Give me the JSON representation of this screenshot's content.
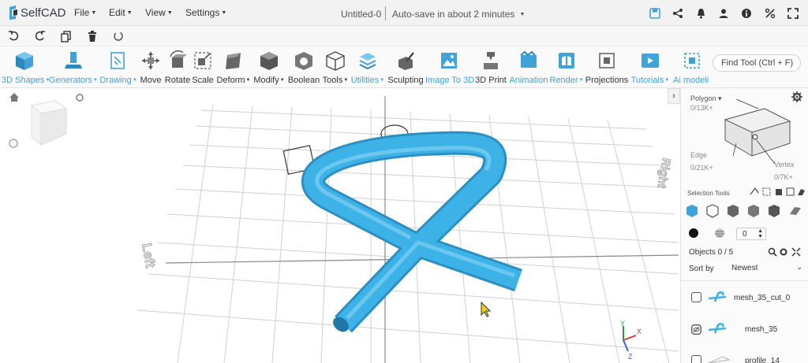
{
  "app": {
    "name": "SelfCAD",
    "doc_title": "Untitled-0",
    "autosave": "Auto-save in about 2 minutes"
  },
  "menu": [
    {
      "label": "File",
      "key": "file"
    },
    {
      "label": "Edit",
      "key": "edit"
    },
    {
      "label": "View",
      "key": "view"
    },
    {
      "label": "Settings",
      "key": "settings"
    }
  ],
  "toolbar": {
    "tools": [
      {
        "label": "3D Shapes",
        "dropdown": true,
        "blue": true
      },
      {
        "label": "Generators",
        "dropdown": true,
        "blue": true
      },
      {
        "label": "Drawing",
        "dropdown": true,
        "blue": true
      },
      {
        "label": "Move",
        "dropdown": false,
        "blue": false
      },
      {
        "label": "Rotate",
        "dropdown": false,
        "blue": false
      },
      {
        "label": "Scale",
        "dropdown": false,
        "blue": false
      },
      {
        "label": "Deform",
        "dropdown": true,
        "blue": false
      },
      {
        "label": "Modify",
        "dropdown": true,
        "blue": false
      },
      {
        "label": "Boolean",
        "dropdown": false,
        "blue": false
      },
      {
        "label": "Tools",
        "dropdown": true,
        "blue": false
      },
      {
        "label": "Utilities",
        "dropdown": true,
        "blue": true
      },
      {
        "label": "Sculpting",
        "dropdown": false,
        "blue": false
      },
      {
        "label": "Image To 3D",
        "dropdown": false,
        "blue": true
      },
      {
        "label": "3D Print",
        "dropdown": false,
        "blue": false
      },
      {
        "label": "Animation",
        "dropdown": false,
        "blue": true
      },
      {
        "label": "Render",
        "dropdown": true,
        "blue": true
      },
      {
        "label": "Projections",
        "dropdown": false,
        "blue": false
      },
      {
        "label": "Tutorials",
        "dropdown": true,
        "blue": true
      },
      {
        "label": "Ai modeli",
        "dropdown": false,
        "blue": true
      }
    ],
    "find_placeholder": "Find Tool (Ctrl + F)"
  },
  "viewport": {
    "left_label": "Left",
    "right_label": "Right",
    "axis": {
      "y": "Y",
      "x": "X",
      "z": "Z"
    }
  },
  "panel": {
    "polygon_label": "Polygon",
    "polygon_count": "0/13K+",
    "edge_label": "Edge",
    "edge_count": "0/21K+",
    "vertex_label": "Vertex",
    "vertex_count": "0/7K+",
    "selection_tools": "Selection Tools",
    "stepper_value": "0",
    "objects_label": "Objects 0 / 5",
    "sort_label": "Sort by",
    "sort_value": "Newest",
    "objects": [
      {
        "name": "mesh_35_cut_0"
      },
      {
        "name": "mesh_35"
      },
      {
        "name": "profile_14"
      }
    ]
  },
  "colors": {
    "accent": "#3fa3d9",
    "model": "#3db2e6",
    "toolbar_bg": "#fafafa"
  }
}
